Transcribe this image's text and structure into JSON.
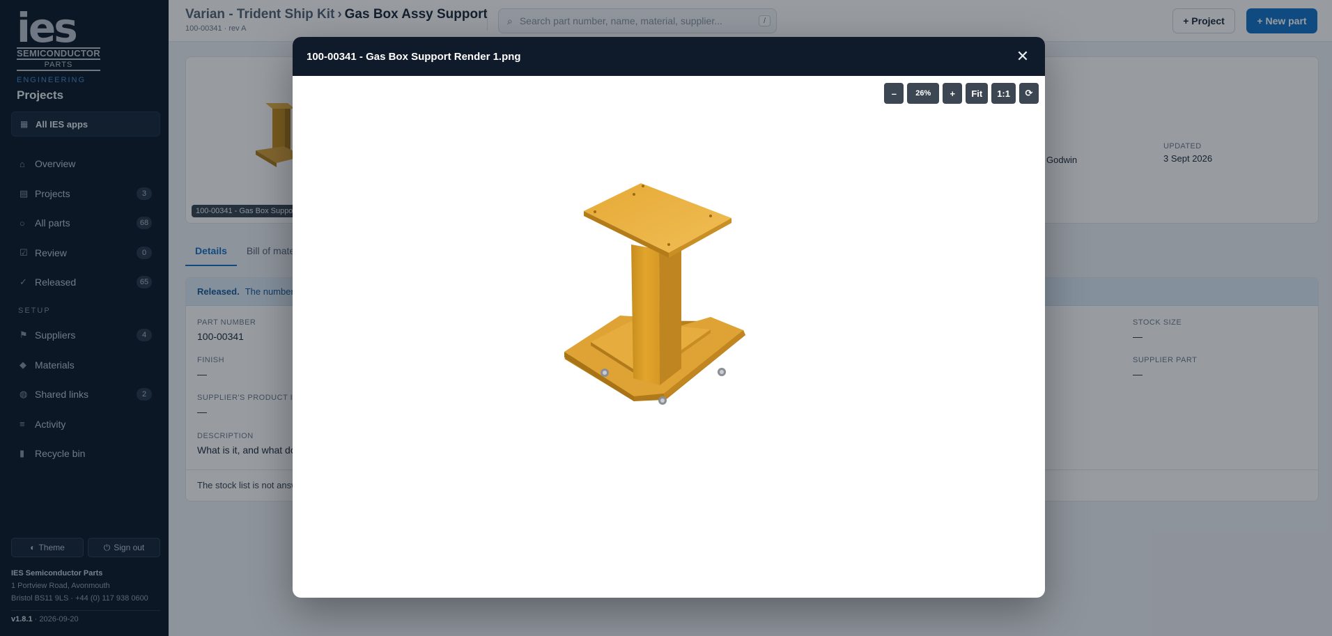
{
  "sidebar": {
    "logo": {
      "main": "ies",
      "line1": "SEMICONDUCTOR",
      "line2": "PARTS"
    },
    "section_label": "ENGINEERING",
    "title": "Projects",
    "all_apps": "All IES apps",
    "nav": [
      {
        "label": "Overview",
        "icon": "home-icon",
        "count": ""
      },
      {
        "label": "Projects",
        "icon": "list-icon",
        "count": "3"
      },
      {
        "label": "All parts",
        "icon": "circle-icon",
        "count": "68"
      },
      {
        "label": "Review",
        "icon": "checkbox-icon",
        "count": "0"
      },
      {
        "label": "Released",
        "icon": "check-icon",
        "count": "65"
      }
    ],
    "setup_label": "SETUP",
    "setup_nav": [
      {
        "label": "Suppliers",
        "icon": "flag-icon",
        "count": "4"
      },
      {
        "label": "Materials",
        "icon": "diamond-icon",
        "count": ""
      },
      {
        "label": "Shared links",
        "icon": "globe-icon",
        "count": "2"
      },
      {
        "label": "Activity",
        "icon": "lines-icon",
        "count": ""
      },
      {
        "label": "Recycle bin",
        "icon": "trash-icon",
        "count": ""
      }
    ],
    "theme_btn": "Theme",
    "signout_btn": "Sign out",
    "company_name": "IES Semiconductor Parts",
    "address1": "1 Portview Road, Avonmouth",
    "address2": "Bristol BS11 9LS · +44 (0) 117 938 0600",
    "version": "v1.8.1",
    "version_date": " · 2026-09-20"
  },
  "header": {
    "crumb_project": "Varian - Trident Ship Kit",
    "crumb_sep": "›",
    "crumb_part": "Gas Box Assy Support",
    "sub": "100-00341 · rev A",
    "search_placeholder": "Search part number, name, material, supplier...",
    "search_kbd": "/",
    "project_btn": "+ Project",
    "new_part_btn": "+ New part"
  },
  "part": {
    "thumb_tag": "100-00341 - Gas Box Suppo",
    "owner_partial": "Godwin",
    "updated_label": "UPDATED",
    "updated_value": "3 Sept 2026"
  },
  "tabs": [
    "Details",
    "Bill of mate"
  ],
  "details": {
    "banner_strong": "Released.",
    "banner_text": "The number,",
    "fields": {
      "part_number_label": "PART NUMBER",
      "part_number": "100-00341",
      "finish_label": "FINISH",
      "finish": "—",
      "supplier_pid_label": "SUPPLIER'S PRODUCT ID",
      "supplier_pid": "—",
      "description_label": "DESCRIPTION",
      "description": "What is it, and what do",
      "stock_size_label": "STOCK SIZE",
      "stock_size": "—",
      "supplier_part_label": "SUPPLIER PART",
      "supplier_part": "—"
    },
    "stock_note": "The stock list is not answ"
  },
  "modal": {
    "title": "100-00341 - Gas Box Support Render 1.png",
    "zoom_out": "–",
    "zoom_level": "26%",
    "zoom_in": "+",
    "fit": "Fit",
    "one_to_one": "1:1",
    "rotate": "⟳",
    "render_color": "#e3a62f"
  }
}
